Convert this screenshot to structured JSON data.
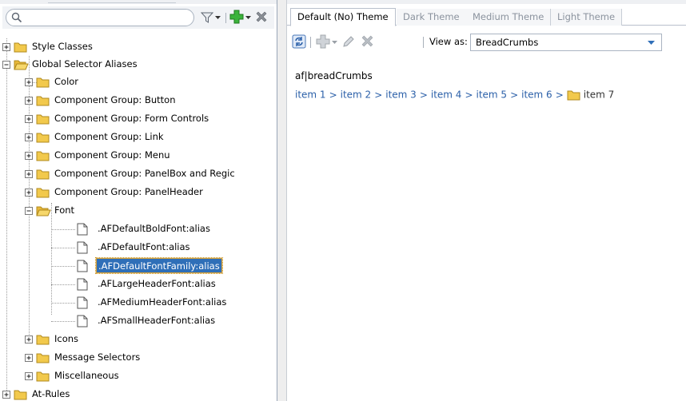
{
  "search": {
    "value": "",
    "placeholder": ""
  },
  "tree": {
    "items": [
      {
        "label": "Style Classes"
      },
      {
        "label": "Global Selector Aliases"
      },
      {
        "label": "Color"
      },
      {
        "label": "Component Group: Button"
      },
      {
        "label": "Component Group: Form Controls"
      },
      {
        "label": "Component Group: Link"
      },
      {
        "label": "Component Group: Menu"
      },
      {
        "label": "Component Group: PanelBox and Regic"
      },
      {
        "label": "Component Group: PanelHeader"
      },
      {
        "label": "Font"
      },
      {
        "label": ".AFDefaultBoldFont:alias"
      },
      {
        "label": ".AFDefaultFont:alias"
      },
      {
        "label": ".AFDefaultFontFamily:alias"
      },
      {
        "label": ".AFLargeHeaderFont:alias"
      },
      {
        "label": ".AFMediumHeaderFont:alias"
      },
      {
        "label": ".AFSmallHeaderFont:alias"
      },
      {
        "label": "Icons"
      },
      {
        "label": "Message Selectors"
      },
      {
        "label": "Miscellaneous"
      },
      {
        "label": "At-Rules"
      }
    ],
    "selected": ".AFDefaultFontFamily:alias"
  },
  "tabs": [
    {
      "label": "Default (No) Theme"
    },
    {
      "label": "Dark Theme"
    },
    {
      "label": "Medium Theme"
    },
    {
      "label": "Light Theme"
    }
  ],
  "toolbar": {
    "view_as_label": "View as:",
    "view_as_value": "BreadCrumbs"
  },
  "preview": {
    "selector": "af|breadCrumbs",
    "crumbs": [
      "item 1",
      "item 2",
      "item 3",
      "item 4",
      "item 5",
      "item 6",
      "item 7"
    ],
    "separator": ">"
  },
  "colors": {
    "selection": "#2f6fb8",
    "folder": "#f2c94c",
    "crumb_link": "#2a5fa8",
    "add_green": "#3bb33b",
    "delete_gray": "#8a8f96"
  }
}
